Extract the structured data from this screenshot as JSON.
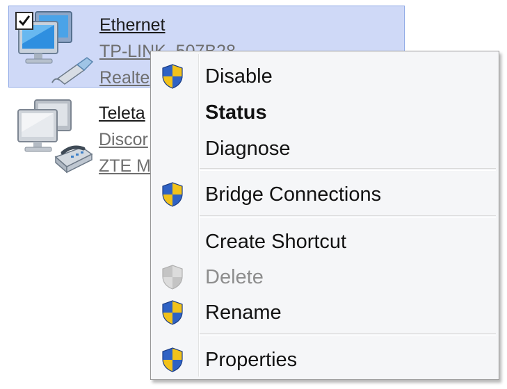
{
  "connections": [
    {
      "name": "Ethernet",
      "status": "TP-LINK_507B28",
      "device": "Realte",
      "selected": true,
      "checked": true,
      "icon": "network-adapter-ethernet-icon"
    },
    {
      "name": "Teleta",
      "status": "Discor",
      "device": "ZTE M",
      "selected": false,
      "checked": false,
      "icon": "network-adapter-dialup-modem-icon"
    }
  ],
  "context_menu": {
    "items": [
      {
        "label": "Disable",
        "shield": true,
        "enabled": true,
        "bold": false
      },
      {
        "label": "Status",
        "shield": false,
        "enabled": true,
        "bold": true
      },
      {
        "label": "Diagnose",
        "shield": false,
        "enabled": true,
        "bold": false
      },
      {
        "label": "Bridge Connections",
        "shield": true,
        "enabled": true,
        "bold": false
      },
      {
        "label": "Create Shortcut",
        "shield": false,
        "enabled": true,
        "bold": false
      },
      {
        "label": "Delete",
        "shield": true,
        "enabled": false,
        "bold": false
      },
      {
        "label": "Rename",
        "shield": true,
        "enabled": true,
        "bold": false
      },
      {
        "label": "Properties",
        "shield": true,
        "enabled": true,
        "bold": false
      }
    ]
  },
  "colors": {
    "selection_background": "#cfd9f7",
    "selection_border": "#8fa9e6",
    "menu_background": "#f5f6f8",
    "shield_blue": "#2f62c4",
    "shield_yellow": "#f2c21a",
    "disabled_text": "#8d8d8d"
  }
}
